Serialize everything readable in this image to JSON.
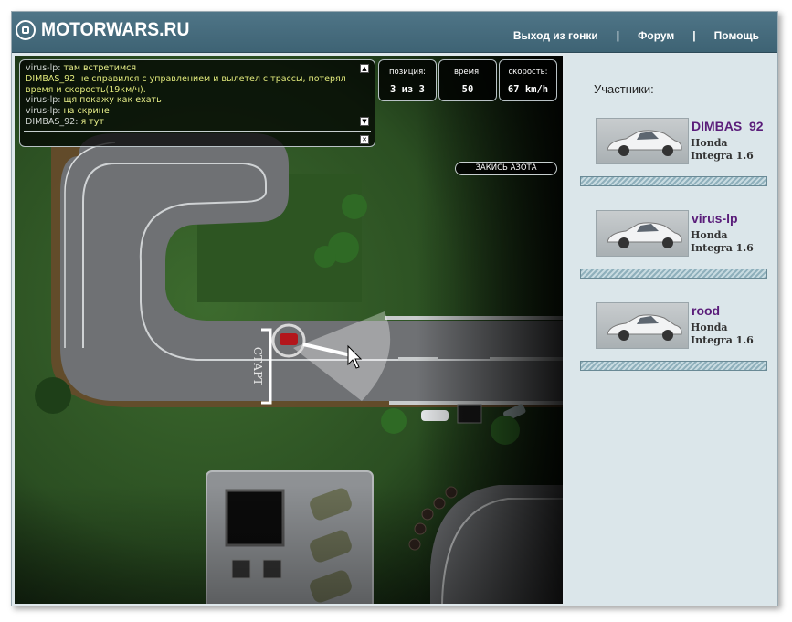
{
  "header": {
    "logo_text": "MOTORWARS.RU",
    "nav": [
      {
        "label": "Выход из гонки"
      },
      {
        "label": "Форум"
      },
      {
        "label": "Помощь"
      }
    ],
    "separator": "|"
  },
  "chat": {
    "lines": [
      {
        "nick": "virus-lp:",
        "msg": "там встретимся"
      },
      {
        "system": "DIMBAS_92 не справился с управлением и вылетел с трассы, потерял время и скорость(19км/ч)."
      },
      {
        "nick": "virus-lp:",
        "msg": "щя покажу как ехать"
      },
      {
        "nick": "virus-lp:",
        "msg": "на скрине"
      },
      {
        "nick": "DIMBAS_92:",
        "msg": "я тут"
      }
    ],
    "scroll_up": "▲",
    "scroll_down": "▼",
    "close": "✕"
  },
  "hud": {
    "position_label": "позиция:",
    "position_value": "3 из 3",
    "time_label": "время:",
    "time_value": "50",
    "speed_label": "скорость:",
    "speed_value": "67 km/h"
  },
  "nitro_button": "ЗАКИСЬ АЗОТА",
  "track": {
    "start_label": "СТАРТ"
  },
  "panel": {
    "title": "Участники:",
    "participants": [
      {
        "name": "DIMBAS_92",
        "car_line1": "Honda",
        "car_line2": "Integra 1.6"
      },
      {
        "name": "virus-lp",
        "car_line1": "Honda",
        "car_line2": "Integra 1.6"
      },
      {
        "name": "rood",
        "car_line1": "Honda",
        "car_line2": "Integra 1.6"
      }
    ]
  },
  "colors": {
    "header": "#46697b",
    "accent_name": "#5a1d7a",
    "chat_text": "#e8ef8a"
  }
}
